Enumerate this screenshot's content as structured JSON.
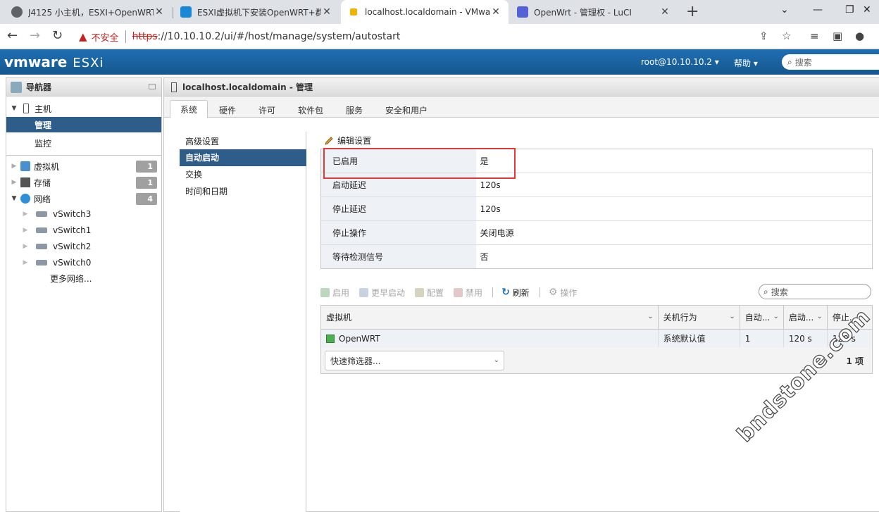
{
  "browser": {
    "tabs": [
      {
        "title": "J4125 小主机，ESXI+OpenWRT",
        "active": false
      },
      {
        "title": "ESXI虚拟机下安装OpenWRT+群",
        "active": false
      },
      {
        "title": "localhost.localdomain - VMwa",
        "active": true
      },
      {
        "title": "OpenWrt - 管理权 - LuCI",
        "active": false
      }
    ],
    "insecure_label": "不安全",
    "url_scheme": "https",
    "url_rest": "://10.10.10.2/ui/#/host/manage/system/autostart"
  },
  "header": {
    "logo_vm": "vmware",
    "logo_product": "ESXi",
    "user": "root@10.10.10.2 ▾",
    "help": "帮助 ▾",
    "search_placeholder": "搜索"
  },
  "navigator": {
    "title": "导航器",
    "host": "主机",
    "manage": "管理",
    "monitor": "监控",
    "vms": {
      "label": "虚拟机",
      "count": "1"
    },
    "storage": {
      "label": "存储",
      "count": "1"
    },
    "network": {
      "label": "网络",
      "count": "4"
    },
    "switches": [
      "vSwitch3",
      "vSwitch1",
      "vSwitch2",
      "vSwitch0"
    ],
    "more_networks": "更多网络..."
  },
  "main": {
    "title": "localhost.localdomain - 管理",
    "tabs": [
      "系统",
      "硬件",
      "许可",
      "软件包",
      "服务",
      "安全和用户"
    ],
    "subnav": [
      "高级设置",
      "自动启动",
      "交换",
      "时间和日期"
    ],
    "edit_settings": "编辑设置",
    "props": [
      {
        "key": "已启用",
        "value": "是"
      },
      {
        "key": "启动延迟",
        "value": "120s"
      },
      {
        "key": "停止延迟",
        "value": "120s"
      },
      {
        "key": "停止操作",
        "value": "关闭电源"
      },
      {
        "key": "等待检测信号",
        "value": "否"
      }
    ],
    "toolbar": {
      "start": "启用",
      "earlier": "更早启动",
      "config": "配置",
      "disable": "禁用",
      "refresh": "刷新",
      "actions": "操作"
    },
    "grid_search_placeholder": "搜索",
    "grid": {
      "columns": [
        "虚拟机",
        "关机行为",
        "自动...",
        "启动...",
        "停止..."
      ],
      "rows": [
        {
          "vm": "OpenWRT",
          "shutdown": "系统默认值",
          "auto": "1",
          "start": "120 s",
          "stop": "120 s"
        }
      ]
    },
    "quick_filter": "快速筛选器...",
    "count": "1 项"
  },
  "watermark": "bndstone.com",
  "colors": {
    "accent": "#2e5d8a",
    "header_blue": "#1e6fb3",
    "highlight_red": "#e53935",
    "insecure_red": "#c5221f"
  }
}
